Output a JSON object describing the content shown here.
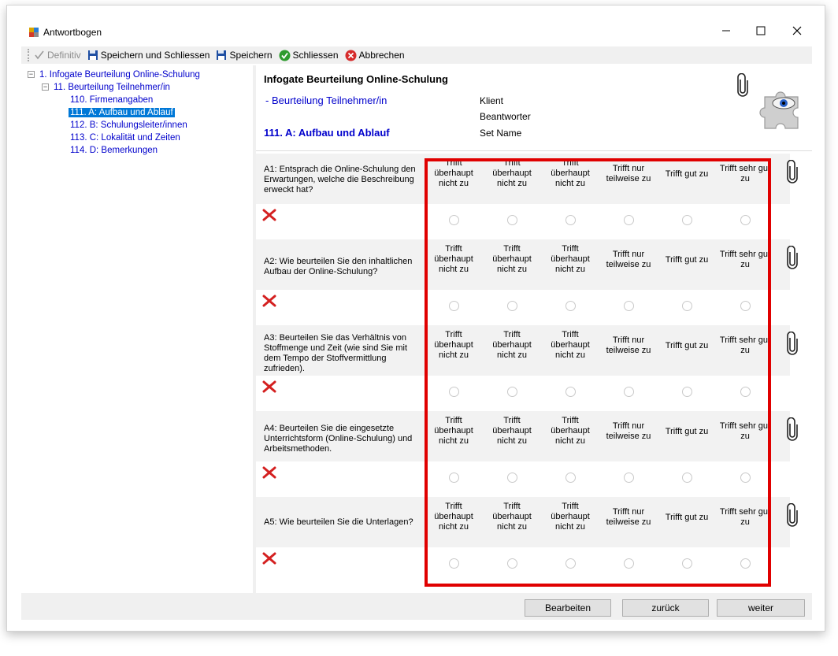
{
  "window": {
    "title": "Antwortbogen"
  },
  "toolbar": {
    "definitiv": "Definitiv",
    "save_close": "Speichern und Schliessen",
    "save": "Speichern",
    "close": "Schliessen",
    "cancel": "Abbrechen"
  },
  "tree": {
    "items": [
      {
        "label": "1. Infogate Beurteilung Online-Schulung"
      },
      {
        "label": "11. Beurteilung Teilnehmer/in"
      },
      {
        "label": "110. Firmenangaben"
      },
      {
        "label": "111. A: Aufbau und Ablauf"
      },
      {
        "label": "112. B: Schulungsleiter/innen"
      },
      {
        "label": "113. C: Lokalität und Zeiten"
      },
      {
        "label": "114. D: Bemerkungen"
      }
    ]
  },
  "header": {
    "title": "Infogate Beurteilung Online-Schulung",
    "subtitle": "- Beurteilung Teilnehmer/in",
    "section": "111. A: Aufbau und Ablauf",
    "meta": [
      "Klient",
      "Beantworter",
      "Set Name"
    ]
  },
  "options": [
    "Trifft überhaupt nicht zu",
    "Trifft überhaupt nicht zu",
    "Trifft überhaupt nicht zu",
    "Trifft nur teilweise zu",
    "Trifft gut zu",
    "Trifft sehr gut zu"
  ],
  "questions": [
    {
      "text": "A1: Entsprach die Online-Schulung den Erwartungen, welche die Beschreibung erweckt hat?"
    },
    {
      "text": "A2: Wie beurteilen Sie den inhaltlichen Aufbau der Online-Schulung?"
    },
    {
      "text": "A3: Beurteilen Sie das Verhältnis von Stoffmenge und Zeit (wie sind Sie mit dem Tempo der Stoffvermittlung zufrieden)."
    },
    {
      "text": "A4: Beurteilen Sie die eingesetzte Unterrichtsform (Online-Schulung) und Arbeitsmethoden."
    },
    {
      "text": "A5: Wie beurteilen Sie die Unterlagen?"
    }
  ],
  "buttons": {
    "edit": "Bearbeiten",
    "back": "zurück",
    "next": "weiter"
  },
  "colors": {
    "highlight": "#e00000",
    "link": "#0000cc",
    "selection": "#0078d7"
  }
}
